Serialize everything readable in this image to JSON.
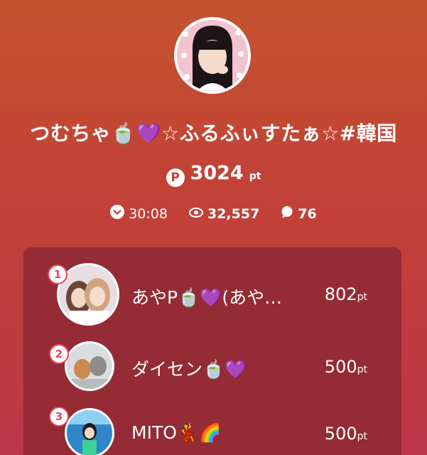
{
  "profile": {
    "name": "つむちゃ🍵💜☆ふるふぃすたぁ☆#韓国",
    "points_value": "3024",
    "points_unit": "pt",
    "points_icon_letter": "P"
  },
  "stats": {
    "duration": "30:08",
    "views": "32,557",
    "comments": "76"
  },
  "ranking": [
    {
      "rank": "1",
      "name": "あやP🍵💜(あや…",
      "points": "802",
      "unit": "pt"
    },
    {
      "rank": "2",
      "name": "ダイセン🍵💜",
      "points": "500",
      "unit": "pt"
    },
    {
      "rank": "3",
      "name": "MITO💃🌈",
      "points": "500",
      "unit": "pt"
    }
  ],
  "colors": {
    "background_top": "#c4532f",
    "background_bottom": "#bd3548",
    "panel": "#952b34",
    "rank_badge": "#e9465a"
  }
}
